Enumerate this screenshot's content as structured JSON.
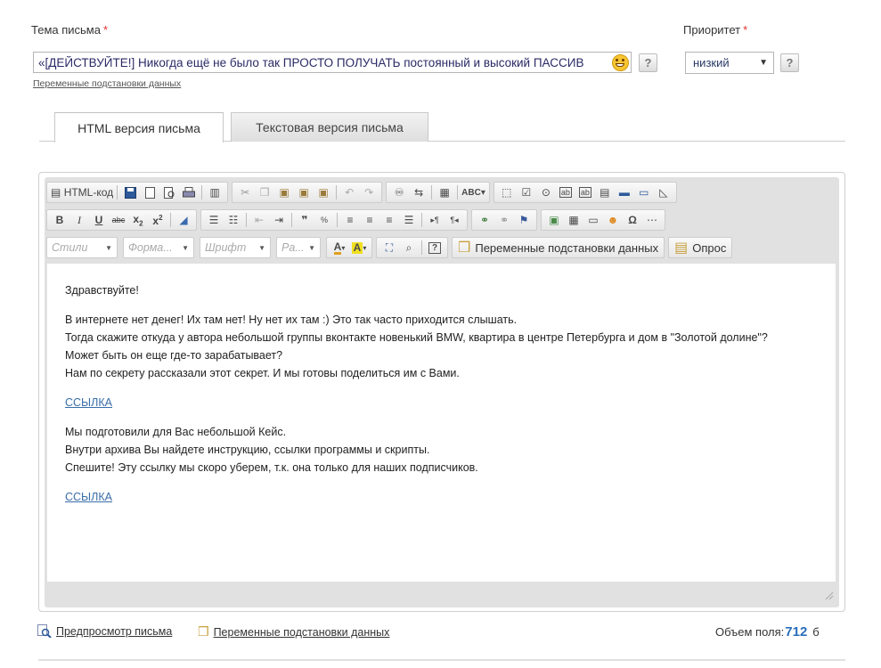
{
  "subject": {
    "label": "Тема письма",
    "required_mark": "*",
    "value": "«[ДЕЙСТВУЙТЕ!] Никогда ещё не было так ПРОСТО ПОЛУЧАТЬ постоянный и высокий ПАССИВ",
    "help": "?",
    "vars_link": "Переменные подстановки данных"
  },
  "priority": {
    "label": "Приоритет",
    "required_mark": "*",
    "selected": "низкий",
    "help": "?"
  },
  "tabs": [
    {
      "label": "HTML версия письма",
      "active": true
    },
    {
      "label": "Текстовая версия письма",
      "active": false
    }
  ],
  "toolbar": {
    "html_code": "HTML-код",
    "styles": "Стили",
    "format": "Форма...",
    "font": "Шрифт",
    "size": "Ра...",
    "vars_button": "Переменные подстановки данных",
    "poll_button": "Опрос"
  },
  "body": {
    "greeting": "Здравствуйте!",
    "p1": [
      "В интернете нет денег! Их там нет! Ну нет их там :) Это так часто приходится слышать.",
      "Тогда скажите откуда у автора небольшой группы вконтакте  новенький BMW, квартира в центре Петербурга и дом в \"Золотой долине\"?",
      "Может быть он еще где-то зарабатывает?",
      "Нам по секрету рассказали этот секрет. И мы готовы поделиться им с Вами."
    ],
    "link1": "ССЫЛКА",
    "p2": [
      "Мы подготовили для Вас небольшой Кейс.",
      "Внутри архива Вы найдете инструкцию, ссылки программы и скрипты.",
      "Спешите! Эту ссылку мы скоро уберем, т.к. она только для наших подписчиков."
    ],
    "link2": "ССЫЛКА"
  },
  "footer": {
    "preview": "Предпросмотр письма",
    "vars": "Переменные подстановки данных",
    "size_label": "Объем поля:",
    "size_value": "712",
    "size_unit": "б"
  },
  "colors": {
    "accent_link": "#3a6ea8",
    "required": "#e03030",
    "size_value": "#2a6ebb"
  }
}
